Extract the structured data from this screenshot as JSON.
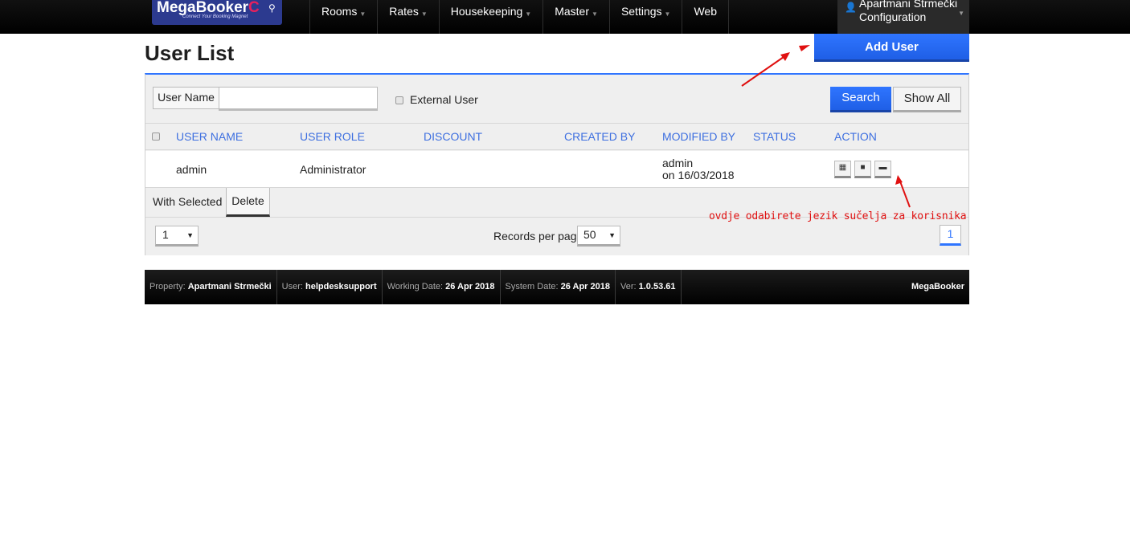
{
  "brand": {
    "logo_main": "MegaBooker",
    "logo_tagline": "Connect Your Booking Magnet"
  },
  "nav": {
    "items": [
      {
        "label": "Rooms"
      },
      {
        "label": "Rates"
      },
      {
        "label": "Housekeeping"
      },
      {
        "label": "Master"
      },
      {
        "label": "Settings"
      },
      {
        "label": "Web"
      }
    ],
    "user_name": "Apartmani Strmečki",
    "user_menu": "Configuration"
  },
  "page": {
    "title": "User List",
    "add_user_label": "Add User"
  },
  "filter": {
    "user_name_label": "User Name",
    "user_name_value": "",
    "external_user_label": "External User",
    "external_user_checked": false,
    "search_label": "Search",
    "show_all_label": "Show All"
  },
  "table": {
    "columns": [
      "USER NAME",
      "USER ROLE",
      "DISCOUNT",
      "CREATED BY",
      "MODIFIED BY",
      "STATUS",
      "ACTION"
    ],
    "rows": [
      {
        "user_name": "admin",
        "user_role": "Administrator",
        "discount": "",
        "created_by": "",
        "modified_by": "admin",
        "modified_on": "on 16/03/2018",
        "status": "",
        "actions": [
          "calculator-icon",
          "lock-icon",
          "comment-icon"
        ]
      }
    ]
  },
  "bulk": {
    "with_selected_label": "With Selected",
    "delete_label": "Delete"
  },
  "pager": {
    "page_select_value": "1",
    "records_per_page_label": "Records per page",
    "records_per_page_value": "50",
    "current_page": "1"
  },
  "annotation": {
    "text": "ovdje odabirete jezik sučelja za korisnika",
    "color": "#e01010"
  },
  "footer": {
    "property_label": "Property:",
    "property_value": "Apartmani Strmečki",
    "user_label": "User:",
    "user_value": "helpdesksupport",
    "working_date_label": "Working Date:",
    "working_date_value": "26 Apr 2018",
    "system_date_label": "System Date:",
    "system_date_value": "26 Apr 2018",
    "version_label": "Ver:",
    "version_value": "1.0.53.61",
    "brand": "MegaBooker"
  },
  "colors": {
    "accent": "#2f75ff",
    "header_text": "#3d6fe0",
    "topbar": "#000000",
    "logo_bg": "#2c3a8f"
  }
}
